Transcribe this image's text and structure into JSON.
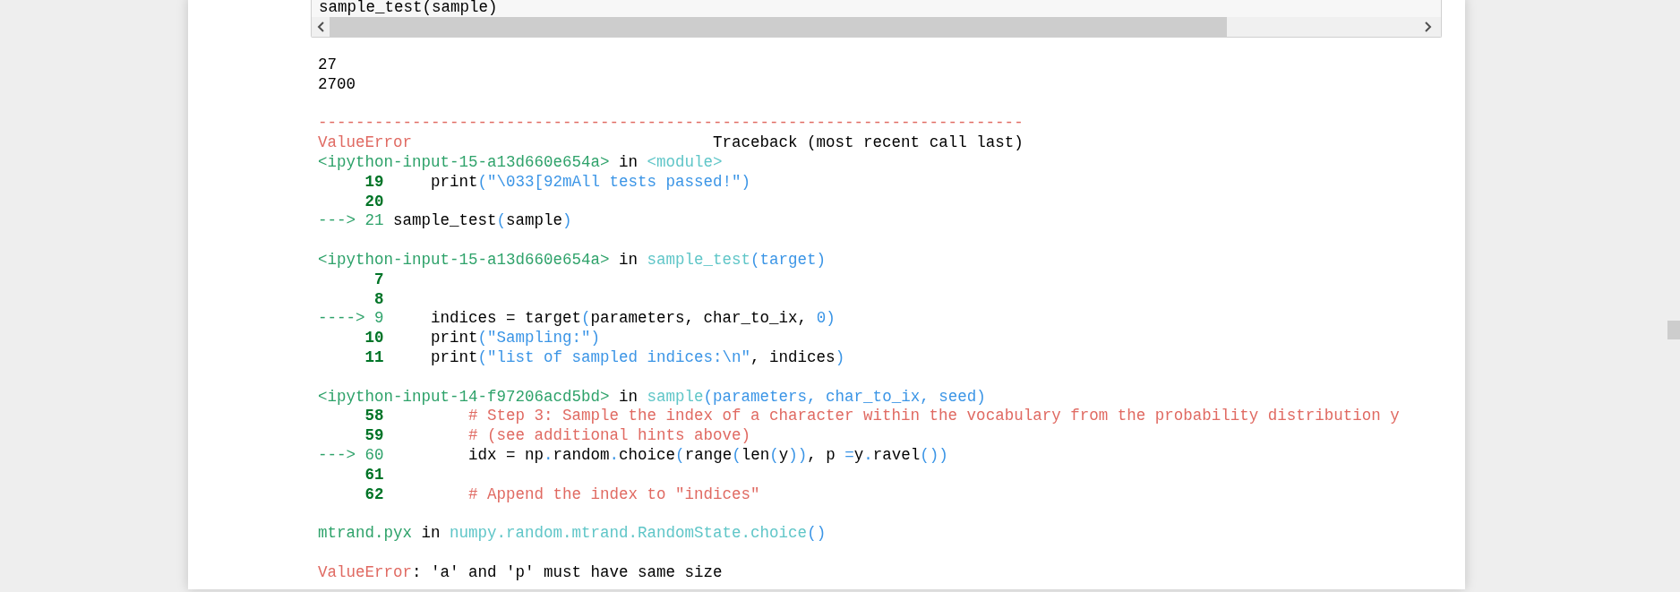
{
  "code_cell": {
    "source": "sample_test(sample)"
  },
  "output": {
    "blocks": [
      [
        [
          {
            "text": "27",
            "kind": "plain"
          }
        ],
        [
          {
            "text": "2700",
            "kind": "plain"
          }
        ]
      ],
      [
        [
          {
            "text": "---------------------------------------------------------------------------",
            "kind": "red"
          }
        ],
        [
          {
            "text": "ValueError",
            "kind": "red"
          },
          {
            "text": "                                Traceback (most recent call last)",
            "kind": "plain"
          }
        ],
        [
          {
            "text": "<ipython-input-15-a13d660e654a>",
            "kind": "green"
          },
          {
            "text": " in ",
            "kind": "plain"
          },
          {
            "text": "<module>",
            "kind": "cyan"
          }
        ],
        [
          {
            "text": "     19",
            "kind": "lineno"
          },
          {
            "text": "     print",
            "kind": "plain"
          },
          {
            "text": "(\"\\033[92mAll tests passed!\")",
            "kind": "blue"
          }
        ],
        [
          {
            "text": "     20",
            "kind": "lineno"
          }
        ],
        [
          {
            "text": "---> 21",
            "kind": "green"
          },
          {
            "text": " sample_test",
            "kind": "plain"
          },
          {
            "text": "(",
            "kind": "blue"
          },
          {
            "text": "sample",
            "kind": "plain"
          },
          {
            "text": ")",
            "kind": "blue"
          }
        ]
      ],
      [
        [
          {
            "text": "<ipython-input-15-a13d660e654a>",
            "kind": "green"
          },
          {
            "text": " in ",
            "kind": "plain"
          },
          {
            "text": "sample_test",
            "kind": "cyan"
          },
          {
            "text": "(target)",
            "kind": "blue"
          }
        ],
        [
          {
            "text": "      7",
            "kind": "lineno"
          }
        ],
        [
          {
            "text": "      8",
            "kind": "lineno"
          }
        ],
        [
          {
            "text": "----> 9",
            "kind": "green"
          },
          {
            "text": "     indices = target",
            "kind": "plain"
          },
          {
            "text": "(",
            "kind": "blue"
          },
          {
            "text": "parameters, char_to_ix, ",
            "kind": "plain"
          },
          {
            "text": "0)",
            "kind": "blue"
          }
        ],
        [
          {
            "text": "     10",
            "kind": "lineno"
          },
          {
            "text": "     print",
            "kind": "plain"
          },
          {
            "text": "(\"Sampling:\")",
            "kind": "blue"
          }
        ],
        [
          {
            "text": "     11",
            "kind": "lineno"
          },
          {
            "text": "     print",
            "kind": "plain"
          },
          {
            "text": "(\"list of sampled indices:\\n\"",
            "kind": "blue"
          },
          {
            "text": ", indices",
            "kind": "plain"
          },
          {
            "text": ")",
            "kind": "blue"
          }
        ]
      ],
      [
        [
          {
            "text": "<ipython-input-14-f97206acd5bd>",
            "kind": "green"
          },
          {
            "text": " in ",
            "kind": "plain"
          },
          {
            "text": "sample",
            "kind": "cyan"
          },
          {
            "text": "(parameters, char_to_ix, seed)",
            "kind": "blue"
          }
        ],
        [
          {
            "text": "     58",
            "kind": "lineno"
          },
          {
            "text": "         # Step 3: Sample the index of a character within the vocabulary from the probability distribution y",
            "kind": "red"
          }
        ],
        [
          {
            "text": "     59",
            "kind": "lineno"
          },
          {
            "text": "         # (see additional hints above)",
            "kind": "red"
          }
        ],
        [
          {
            "text": "---> 60",
            "kind": "green"
          },
          {
            "text": "         idx = np",
            "kind": "plain"
          },
          {
            "text": ".",
            "kind": "blue"
          },
          {
            "text": "random",
            "kind": "plain"
          },
          {
            "text": ".",
            "kind": "blue"
          },
          {
            "text": "choice",
            "kind": "plain"
          },
          {
            "text": "(",
            "kind": "blue"
          },
          {
            "text": "range",
            "kind": "plain"
          },
          {
            "text": "(",
            "kind": "blue"
          },
          {
            "text": "len",
            "kind": "plain"
          },
          {
            "text": "(",
            "kind": "blue"
          },
          {
            "text": "y",
            "kind": "plain"
          },
          {
            "text": "))",
            "kind": "blue"
          },
          {
            "text": ", p ",
            "kind": "plain"
          },
          {
            "text": "=",
            "kind": "blue"
          },
          {
            "text": "y",
            "kind": "plain"
          },
          {
            "text": ".",
            "kind": "blue"
          },
          {
            "text": "ravel",
            "kind": "plain"
          },
          {
            "text": "())",
            "kind": "blue"
          }
        ],
        [
          {
            "text": "     61",
            "kind": "lineno"
          }
        ],
        [
          {
            "text": "     62",
            "kind": "lineno"
          },
          {
            "text": "         # Append the index to \"indices\"",
            "kind": "red"
          }
        ]
      ],
      [
        [
          {
            "text": "mtrand.pyx",
            "kind": "green"
          },
          {
            "text": " in ",
            "kind": "plain"
          },
          {
            "text": "numpy.random.mtrand.RandomState.choice",
            "kind": "cyan"
          },
          {
            "text": "()",
            "kind": "blue"
          }
        ]
      ],
      [
        [
          {
            "text": "ValueError",
            "kind": "red"
          },
          {
            "text": ": 'a' and 'p' must have same size",
            "kind": "plain"
          }
        ]
      ]
    ]
  }
}
